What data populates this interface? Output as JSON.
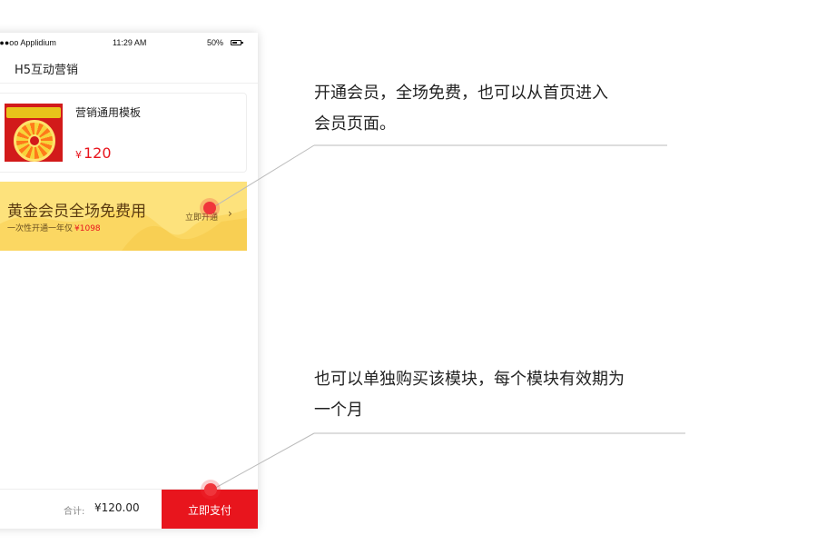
{
  "status_bar": {
    "carrier": "●●●oo Applidium",
    "time": "11:29 AM",
    "battery": "50%"
  },
  "nav": {
    "title": "H5互动营销"
  },
  "product": {
    "name": "营销通用模板",
    "currency": "¥",
    "price": "120"
  },
  "vip_banner": {
    "title": "黄金会员全场免费用",
    "subtitle": "一次性开通一年仅",
    "price": "¥1098",
    "cta": "立即开通",
    "chevron": "›"
  },
  "bottom_bar": {
    "total_label": "合计:",
    "total_value": "¥120.00",
    "pay_label": "立即支付"
  },
  "annotations": {
    "vip_line1": "开通会员，全场免费，也可以从首页进入",
    "vip_line2": "会员页面。",
    "pay_line1": "也可以单独购买该模块，每个模块有效期为",
    "pay_line2": "一个月"
  },
  "colors": {
    "accent_red": "#e8151d",
    "vip_gold": "#fde27c",
    "hotspot": "#f0353b"
  },
  "icons": {
    "back": "chevron-left-icon",
    "battery": "battery-icon"
  }
}
